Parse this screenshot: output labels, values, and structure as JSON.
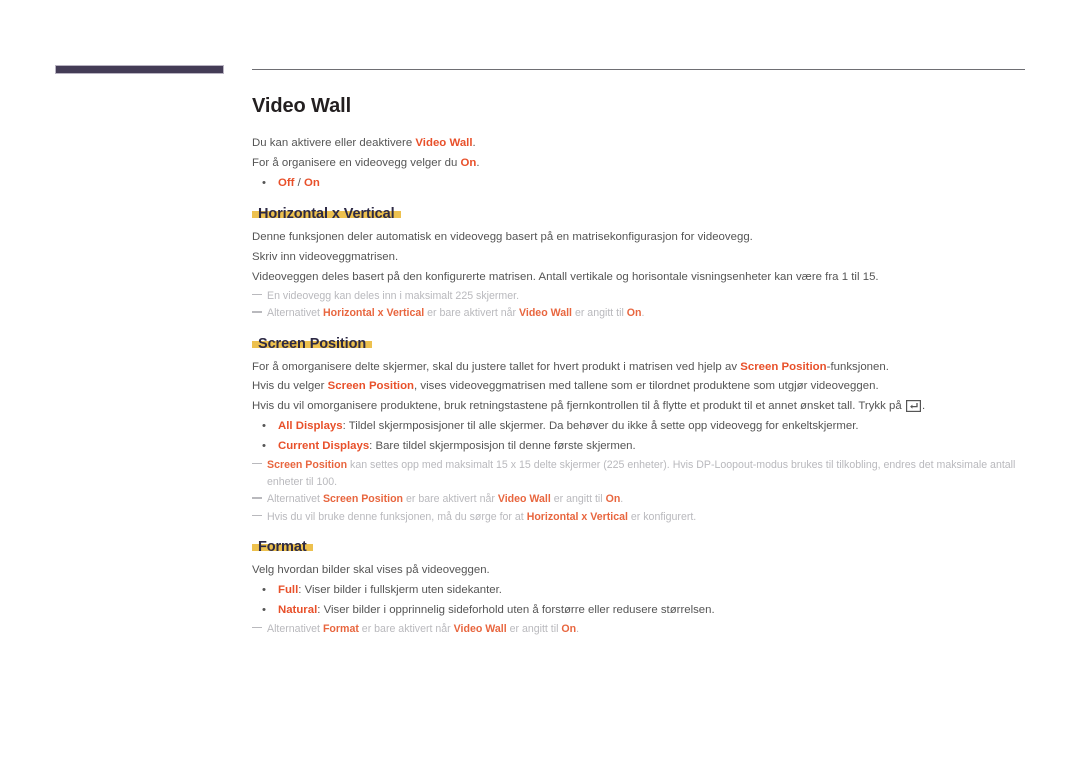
{
  "document": {
    "title": "Video Wall",
    "language": "no"
  },
  "decor": {
    "left_bar_color": "#443c56",
    "rule_color": "#6e6e73",
    "highlight_color": "#edc14f",
    "accent_color": "#e8502a",
    "body_color": "#555555",
    "note_color": "#b9b9bd"
  },
  "sections": {
    "video_wall": {
      "heading": "Video Wall",
      "paragraphs": [
        {
          "runs": [
            {
              "t": "Du kan aktivere eller deaktivere ",
              "s": "n"
            },
            {
              "t": "Video Wall",
              "s": "b"
            },
            {
              "t": ".",
              "s": "n"
            }
          ]
        },
        {
          "runs": [
            {
              "t": "For å organisere en videovegg velger du ",
              "s": "n"
            },
            {
              "t": "On",
              "s": "b"
            },
            {
              "t": ".",
              "s": "n"
            }
          ]
        }
      ],
      "bullets": [
        {
          "runs": [
            {
              "t": "Off",
              "s": "b"
            },
            {
              "t": " / ",
              "s": "n"
            },
            {
              "t": "On",
              "s": "b"
            }
          ]
        }
      ]
    },
    "horizontal_x_vertical": {
      "heading": "Horizontal x Vertical",
      "paragraphs": [
        {
          "runs": [
            {
              "t": "Denne funksjonen deler automatisk en videovegg basert på en matrisekonfigurasjon for videovegg.",
              "s": "n"
            }
          ]
        },
        {
          "runs": [
            {
              "t": "Skriv inn videoveggmatrisen.",
              "s": "n"
            }
          ]
        },
        {
          "runs": [
            {
              "t": "Videoveggen deles basert på den konfigurerte matrisen. Antall vertikale og horisontale visningsenheter kan være fra 1 til 15.",
              "s": "n"
            }
          ]
        }
      ],
      "notes": [
        {
          "runs": [
            {
              "t": "En videovegg kan deles inn i maksimalt 225 skjermer.",
              "s": "n"
            }
          ]
        },
        {
          "runs": [
            {
              "t": "Alternativet ",
              "s": "n"
            },
            {
              "t": "Horizontal x Vertical",
              "s": "b"
            },
            {
              "t": " er bare aktivert når ",
              "s": "n"
            },
            {
              "t": "Video Wall",
              "s": "b"
            },
            {
              "t": " er angitt til ",
              "s": "n"
            },
            {
              "t": "On",
              "s": "b"
            },
            {
              "t": ".",
              "s": "n"
            }
          ]
        }
      ]
    },
    "screen_position": {
      "heading": "Screen Position",
      "paragraphs": [
        {
          "runs": [
            {
              "t": "For å omorganisere delte skjermer, skal du justere tallet for hvert produkt i matrisen ved hjelp av ",
              "s": "n"
            },
            {
              "t": "Screen Position",
              "s": "b"
            },
            {
              "t": "-funksjonen.",
              "s": "n"
            }
          ]
        },
        {
          "runs": [
            {
              "t": "Hvis du velger ",
              "s": "n"
            },
            {
              "t": "Screen Position",
              "s": "b"
            },
            {
              "t": ", vises videoveggmatrisen med tallene som er tilordnet produktene som utgjør videoveggen.",
              "s": "n"
            }
          ]
        },
        {
          "runs": [
            {
              "t": "Hvis du vil omorganisere produktene, bruk retningstastene på fjernkontrollen til å flytte et produkt til et annet ønsket tall. Trykk på ",
              "s": "n"
            },
            {
              "t": "enter-key-icon",
              "s": "icon"
            },
            {
              "t": ".",
              "s": "n"
            }
          ]
        }
      ],
      "bullets": [
        {
          "runs": [
            {
              "t": "All Displays",
              "s": "b"
            },
            {
              "t": ": Tildel skjermposisjoner til alle skjermer. Da behøver du ikke å sette opp videovegg for enkeltskjermer.",
              "s": "n"
            }
          ]
        },
        {
          "runs": [
            {
              "t": "Current Displays",
              "s": "b"
            },
            {
              "t": ": Bare tildel skjermposisjon til denne første skjermen.",
              "s": "n"
            }
          ]
        }
      ],
      "notes": [
        {
          "runs": [
            {
              "t": "Screen Position",
              "s": "b"
            },
            {
              "t": " kan settes opp med maksimalt 15 x 15 delte skjermer (225 enheter). Hvis DP-Loopout-modus brukes til tilkobling, endres det maksimale antall enheter til 100.",
              "s": "n"
            }
          ]
        },
        {
          "runs": [
            {
              "t": "Alternativet ",
              "s": "n"
            },
            {
              "t": "Screen Position",
              "s": "b"
            },
            {
              "t": " er bare aktivert når ",
              "s": "n"
            },
            {
              "t": "Video Wall",
              "s": "b"
            },
            {
              "t": " er angitt til ",
              "s": "n"
            },
            {
              "t": "On",
              "s": "b"
            },
            {
              "t": ".",
              "s": "n"
            }
          ]
        },
        {
          "runs": [
            {
              "t": "Hvis du vil bruke denne funksjonen, må du sørge for at ",
              "s": "n"
            },
            {
              "t": "Horizontal x Vertical",
              "s": "b"
            },
            {
              "t": " er konfigurert.",
              "s": "n"
            }
          ]
        }
      ]
    },
    "format": {
      "heading": "Format",
      "paragraphs": [
        {
          "runs": [
            {
              "t": "Velg hvordan bilder skal vises på videoveggen.",
              "s": "n"
            }
          ]
        }
      ],
      "bullets": [
        {
          "runs": [
            {
              "t": "Full",
              "s": "b"
            },
            {
              "t": ": Viser bilder i fullskjerm uten sidekanter.",
              "s": "n"
            }
          ]
        },
        {
          "runs": [
            {
              "t": "Natural",
              "s": "b"
            },
            {
              "t": ": Viser bilder i opprinnelig sideforhold uten å forstørre eller redusere størrelsen.",
              "s": "n"
            }
          ]
        }
      ],
      "notes": [
        {
          "runs": [
            {
              "t": "Alternativet ",
              "s": "n"
            },
            {
              "t": "Format",
              "s": "b"
            },
            {
              "t": " er bare aktivert når ",
              "s": "n"
            },
            {
              "t": "Video Wall",
              "s": "b"
            },
            {
              "t": " er angitt til ",
              "s": "n"
            },
            {
              "t": "On",
              "s": "b"
            },
            {
              "t": ".",
              "s": "n"
            }
          ]
        }
      ]
    }
  },
  "bullet_glyph": "•"
}
